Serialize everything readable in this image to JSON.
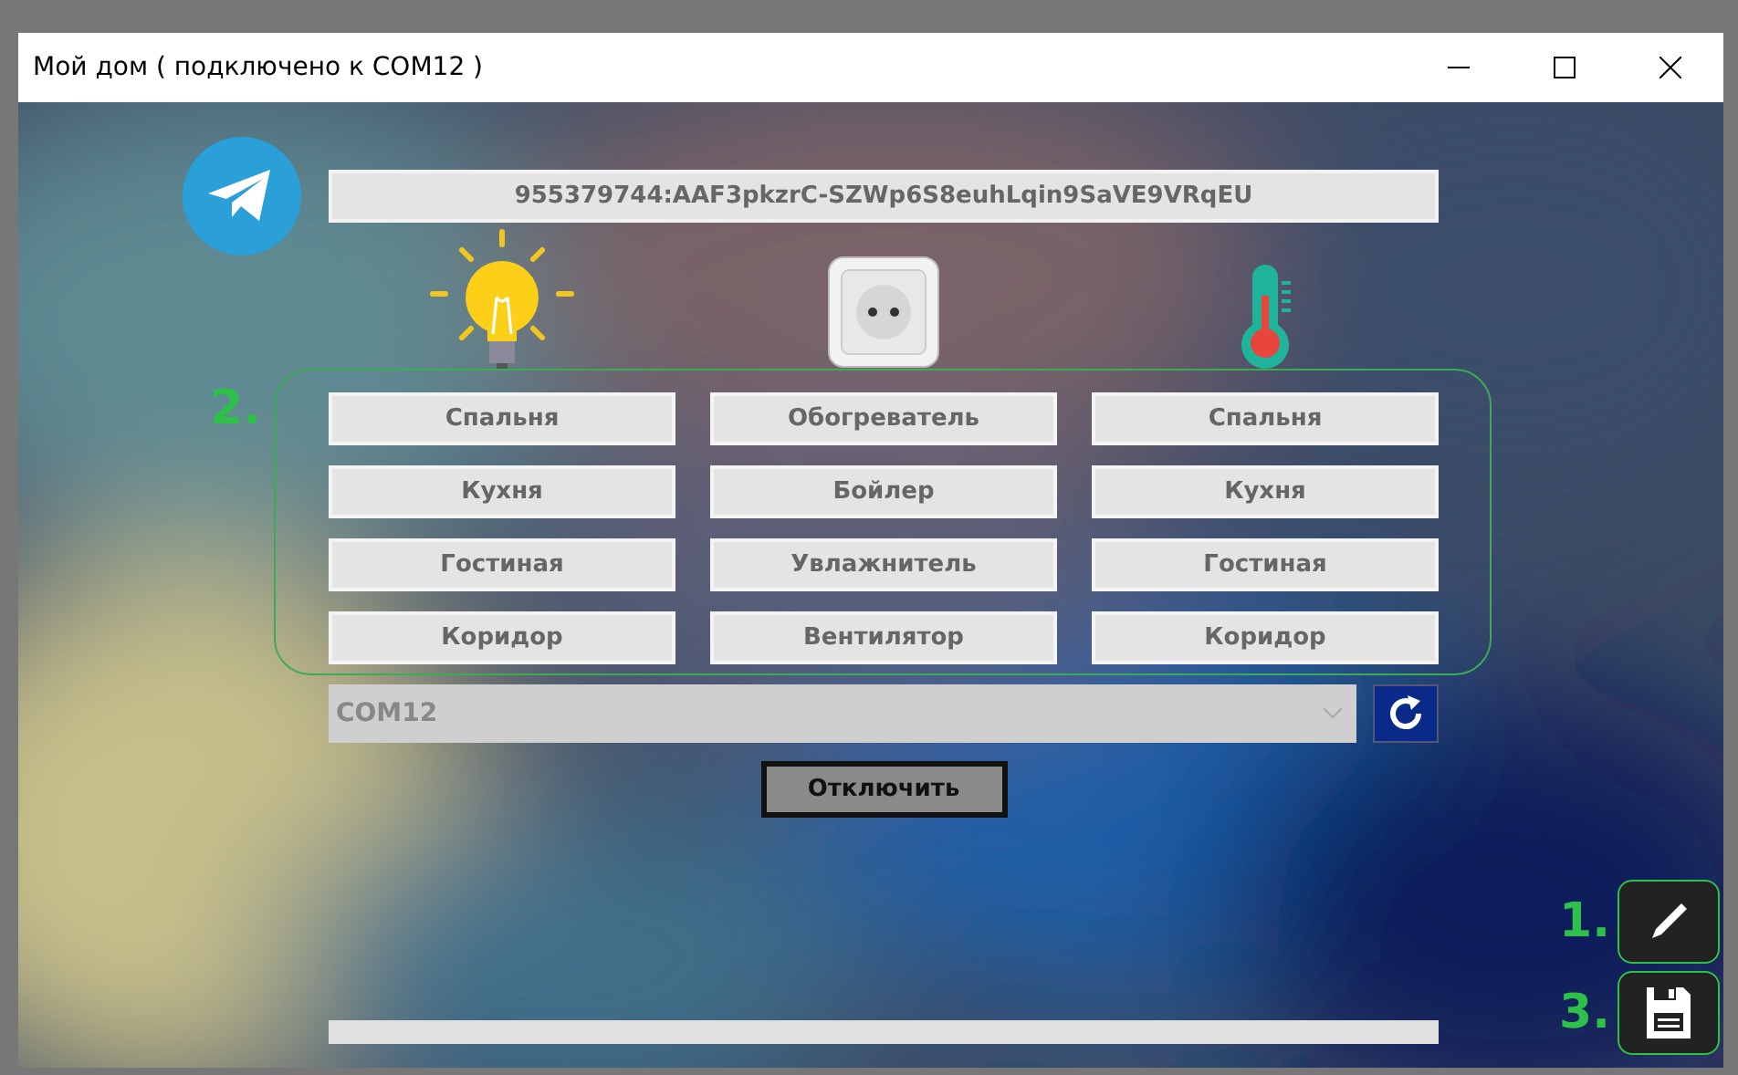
{
  "window": {
    "title": "Мой дом ( подключено к COM12 )"
  },
  "token": {
    "value": "955379744:AAF3pkzrC-SZWp6S8euhLqin9SaVE9VRqEU"
  },
  "group": {
    "label": "2.",
    "columns": [
      {
        "kind": "light",
        "buttons": [
          "Спальня",
          "Кухня",
          "Гостиная",
          "Коридор"
        ]
      },
      {
        "kind": "socket",
        "buttons": [
          "Обогреватель",
          "Бойлер",
          "Увлажнитель",
          "Вентилятор"
        ]
      },
      {
        "kind": "thermometer",
        "buttons": [
          "Спальня",
          "Кухня",
          "Гостиная",
          "Коридор"
        ]
      }
    ]
  },
  "port": {
    "value": "COM12"
  },
  "disconnect_button": "Отключить",
  "side_buttons": [
    {
      "label": "1.",
      "kind": "edit"
    },
    {
      "label": "3.",
      "kind": "save"
    }
  ]
}
